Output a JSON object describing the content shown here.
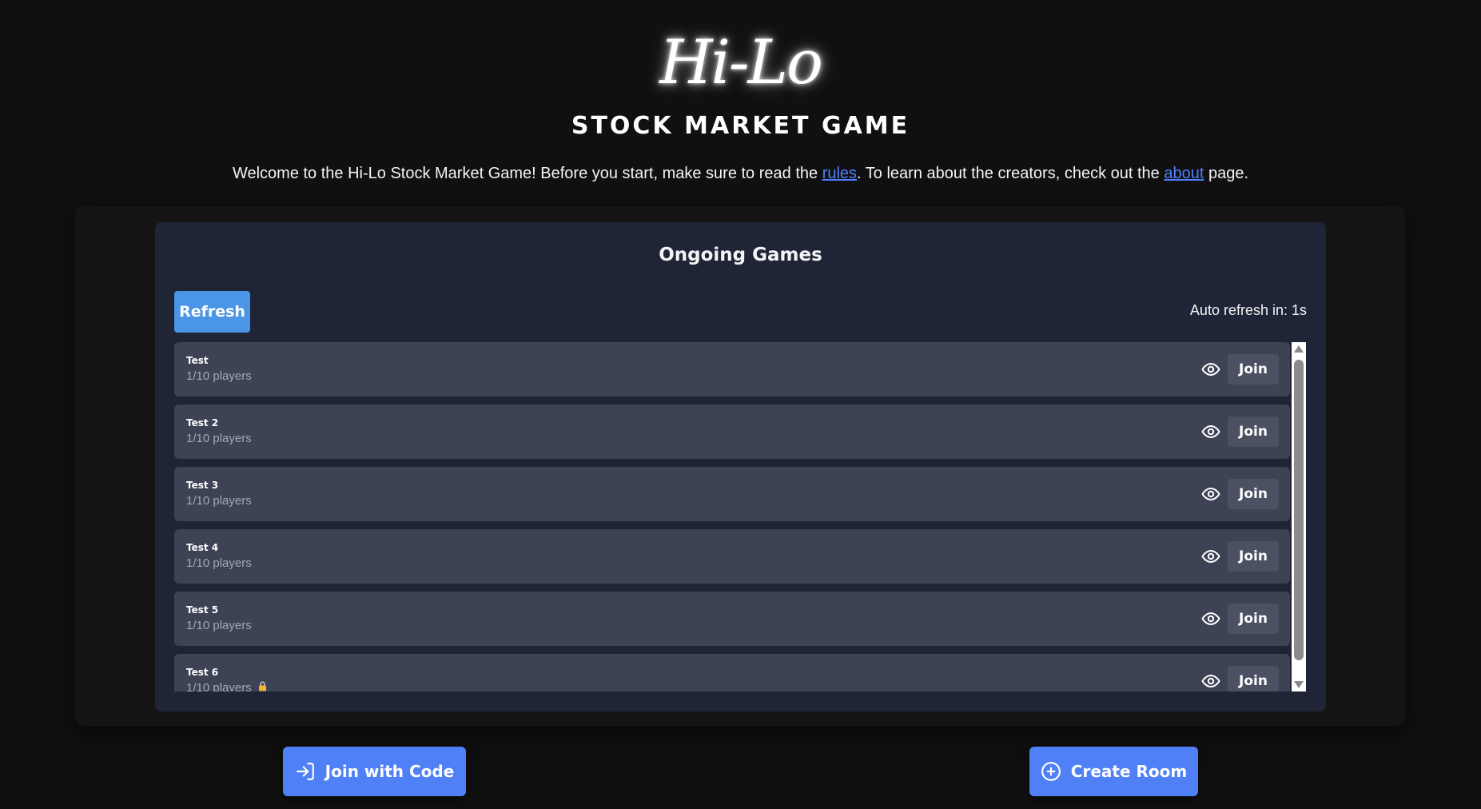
{
  "header": {
    "logo_text": "Hi-Lo",
    "subtitle": "STOCK MARKET GAME",
    "welcome_prefix": "Welcome to the Hi-Lo Stock Market Game! Before you start, make sure to read the ",
    "rules_link": "rules",
    "welcome_middle": ". To learn about the creators, check out the ",
    "about_link": "about",
    "welcome_suffix": " page."
  },
  "games_panel": {
    "title": "Ongoing Games",
    "refresh_label": "Refresh",
    "auto_refresh_text": "Auto refresh in: 1s",
    "join_label": "Join",
    "games": [
      {
        "name": "Test",
        "players": "1/10 players",
        "locked": false
      },
      {
        "name": "Test 2",
        "players": "1/10 players",
        "locked": false
      },
      {
        "name": "Test 3",
        "players": "1/10 players",
        "locked": false
      },
      {
        "name": "Test 4",
        "players": "1/10 players",
        "locked": false
      },
      {
        "name": "Test 5",
        "players": "1/10 players",
        "locked": false
      },
      {
        "name": "Test 6",
        "players": "1/10 players",
        "locked": true
      }
    ]
  },
  "actions": {
    "join_with_code_label": "Join with Code",
    "create_room_label": "Create Room"
  },
  "icons": {
    "spectate": "eye-icon",
    "lock": "lock-icon",
    "join_code": "login-icon",
    "create_room": "plus-circle-icon"
  },
  "colors": {
    "background": "#101011",
    "panel": "#1f2536",
    "row": "#3d4255",
    "primary_button": "#4f80f5",
    "refresh_button": "#4b95e6",
    "link": "#4f7fff"
  }
}
